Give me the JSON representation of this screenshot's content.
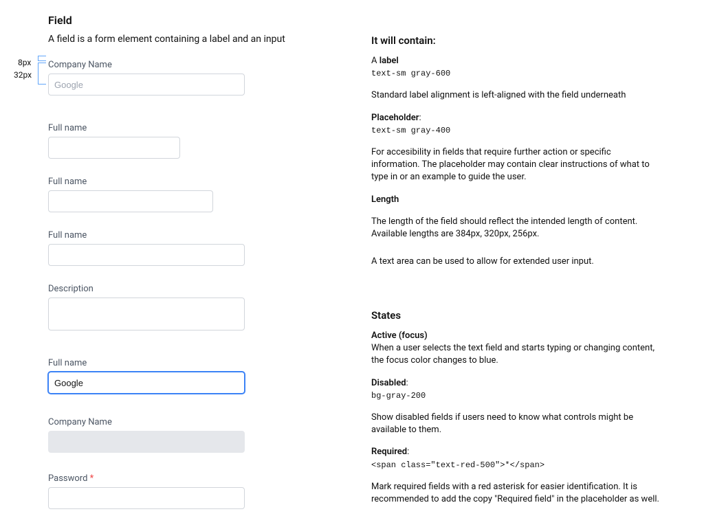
{
  "title": "Field",
  "lead": "A field is a form element containing a label and an input",
  "annotations": {
    "eight": "8px",
    "thirtytwo": "32px"
  },
  "fields": {
    "company1": {
      "label": "Company Name",
      "placeholder": "Google"
    },
    "full1": {
      "label": "Full name"
    },
    "full2": {
      "label": "Full name"
    },
    "full3": {
      "label": "Full name"
    },
    "description": {
      "label": "Description"
    },
    "focused": {
      "label": "Full name",
      "value": "Google"
    },
    "disabled": {
      "label": "Company Name"
    },
    "password": {
      "label": "Password",
      "star": " *"
    }
  },
  "contain": {
    "heading": "It will contain:",
    "label_title_a": "A ",
    "label_title_b": "label",
    "label_code": "text-sm gray-600",
    "label_desc": "Standard label alignment is left-aligned with the field underneath",
    "ph_title": "Placeholder",
    "ph_colon": ":",
    "ph_code": "text-sm gray-400",
    "ph_desc": "For accesibility in fields that require further action or specific information. The placeholder may contain clear instructions of what to type in or an example to guide the user.",
    "len_title": "Length",
    "len_desc": "The length of the field should reflect the intended length of content. Available lengths are 384px, 320px, 256px.",
    "textarea_desc": "A text area can be used to allow for extended user input."
  },
  "states": {
    "heading": "States",
    "active_title": "Active (focus)",
    "active_desc": "When a user selects the text field and starts typing or changing content, the focus color changes to blue.",
    "disabled_title": "Disabled",
    "disabled_colon": ":",
    "disabled_code": "bg-gray-200",
    "disabled_desc": "Show disabled fields if users need to know what controls might be available to them.",
    "required_title": "Required",
    "required_colon": ":",
    "required_code": "<span class=\"text-red-500\">*</span>",
    "required_desc": "Mark required fields with a red asterisk for easier identification. It is recommended to add the copy \"Required field\" in the placeholder as well."
  }
}
